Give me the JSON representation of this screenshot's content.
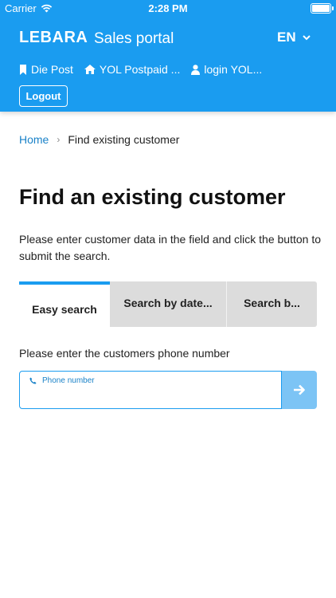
{
  "status_bar": {
    "carrier": "Carrier",
    "time": "2:28 PM"
  },
  "header": {
    "brand": "LEBARA",
    "portal_title": "Sales portal",
    "language": "EN",
    "nav": [
      {
        "label": "Die Post",
        "icon": "bookmark-icon"
      },
      {
        "label": "YOL Postpaid ...",
        "icon": "home-icon"
      },
      {
        "label": "login YOL...",
        "icon": "user-icon"
      }
    ],
    "logout_label": "Logout"
  },
  "breadcrumb": {
    "home": "Home",
    "current": "Find existing customer"
  },
  "page": {
    "title": "Find an existing customer",
    "intro": "Please enter customer data in the field and click the button to submit the search."
  },
  "tabs": [
    {
      "label": "Easy search",
      "active": true
    },
    {
      "label": "Search by date...",
      "active": false
    },
    {
      "label": "Search b...",
      "active": false
    }
  ],
  "search": {
    "instruction": "Please enter the customers phone number",
    "field_label": "Phone number",
    "value": ""
  },
  "colors": {
    "primary": "#1a9cf0",
    "button_disabled": "#7cc4f5",
    "tab_inactive": "#dcdcdc"
  }
}
